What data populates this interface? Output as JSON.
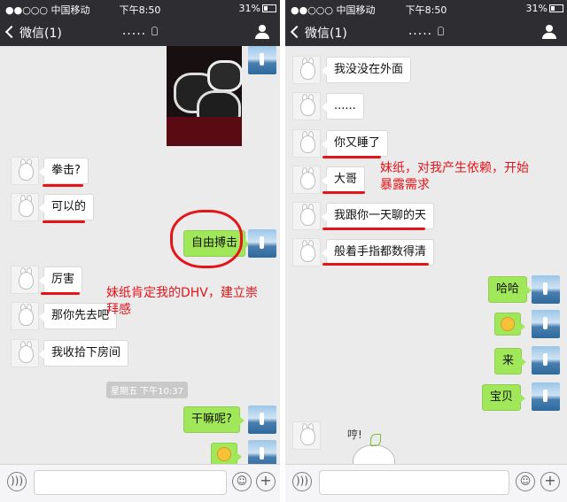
{
  "status_bar": {
    "carrier": "●●○○○ 中国移动",
    "time": "下午8:50",
    "battery": "31%"
  },
  "nav": {
    "back_label": "微信(1)",
    "title": "....."
  },
  "input_bar": {
    "voice_icon": "voice-icon",
    "emoji_icon": "emoji-icon",
    "plus_icon": "plus-icon"
  },
  "left_screen": {
    "messages": [
      {
        "from": "other",
        "text": "拳击?"
      },
      {
        "from": "other",
        "text": "可以的"
      },
      {
        "from": "self",
        "text": "自由搏击"
      },
      {
        "from": "other",
        "text": "厉害"
      },
      {
        "from": "other",
        "text": "那你先去吧"
      },
      {
        "from": "other",
        "text": "我收拾下房间"
      },
      {
        "from": "self",
        "text": "干嘛呢?"
      }
    ],
    "timestamp": "星期五 下午10:37",
    "annotation": "妹纸肯定我的DHV，建立崇拜感"
  },
  "right_screen": {
    "messages": [
      {
        "from": "other",
        "text": "我没没在外面"
      },
      {
        "from": "other",
        "text": "......"
      },
      {
        "from": "other",
        "text": "你又睡了"
      },
      {
        "from": "other",
        "text": "大哥"
      },
      {
        "from": "other",
        "text": "我跟你一天聊的天"
      },
      {
        "from": "other",
        "text": "般着手指都数得清"
      },
      {
        "from": "self",
        "text": "哈哈"
      },
      {
        "from": "self",
        "text": "来"
      },
      {
        "from": "self",
        "text": "宝贝"
      }
    ],
    "annotation": "妹纸，对我产生依赖，开始暴露需求",
    "sticker_text": "哼!"
  }
}
